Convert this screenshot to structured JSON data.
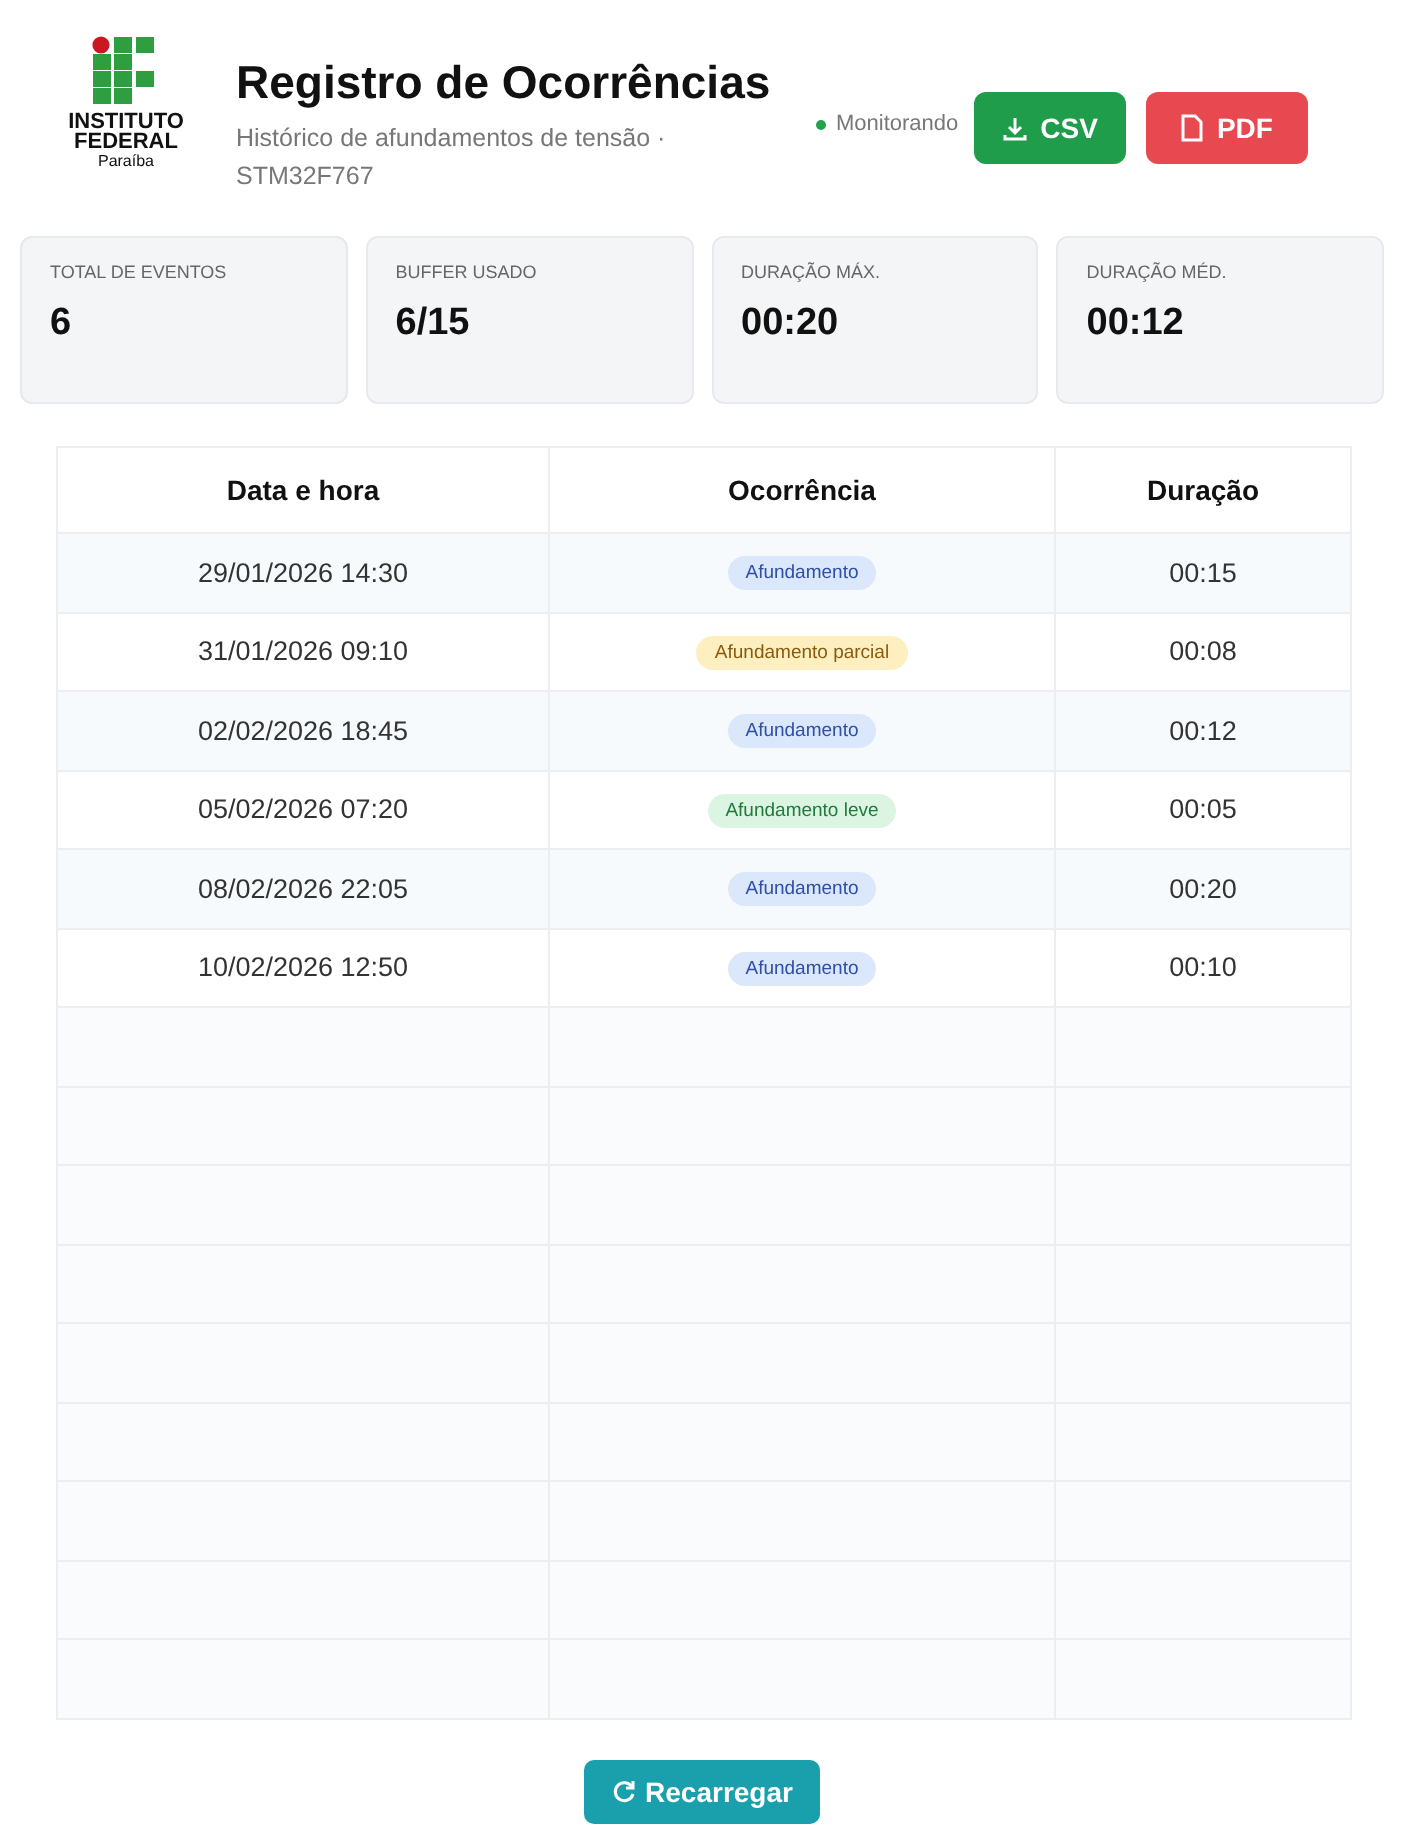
{
  "logo": {
    "line_1": "INSTITUTO",
    "line_2": "FEDERAL",
    "line_3": "Paraíba"
  },
  "header": {
    "title": "Registro de Ocorrências",
    "subtitle": "Histórico de afundamentos de tensão · STM32F767",
    "status": {
      "label": "Monitorando",
      "on": true
    },
    "buttons": [
      {
        "label": "CSV",
        "kind": "csv"
      },
      {
        "label": "PDF",
        "kind": "pdf"
      }
    ]
  },
  "stats": [
    {
      "label": "TOTAL DE EVENTOS",
      "value": "6"
    },
    {
      "label": "BUFFER USADO",
      "value": "6/15"
    },
    {
      "label": "DURAÇÃO MÁX.",
      "value": "00:20"
    },
    {
      "label": "DURAÇÃO MÉD.",
      "value": "00:12"
    }
  ],
  "table": {
    "columns": [
      "Data e hora",
      "Ocorrência",
      "Duração"
    ],
    "rows": [
      {
        "kind": "event",
        "datetime": "29/01/2026 14:30",
        "event": {
          "label": "Afundamento",
          "kind": "full"
        },
        "duration": "00:15"
      },
      {
        "kind": "event",
        "datetime": "31/01/2026 09:10",
        "event": {
          "label": "Afundamento parcial",
          "kind": "partial"
        },
        "duration": "00:08"
      },
      {
        "kind": "event",
        "datetime": "02/02/2026 18:45",
        "event": {
          "label": "Afundamento",
          "kind": "full"
        },
        "duration": "00:12"
      },
      {
        "kind": "event",
        "datetime": "05/02/2026 07:20",
        "event": {
          "label": "Afundamento leve",
          "kind": "light"
        },
        "duration": "00:05"
      },
      {
        "kind": "event",
        "datetime": "08/02/2026 22:05",
        "event": {
          "label": "Afundamento",
          "kind": "full"
        },
        "duration": "00:20"
      },
      {
        "kind": "event",
        "datetime": "10/02/2026 12:50",
        "event": {
          "label": "Afundamento",
          "kind": "full"
        },
        "duration": "00:10"
      },
      {
        "kind": "empty"
      },
      {
        "kind": "empty"
      },
      {
        "kind": "empty"
      },
      {
        "kind": "empty"
      },
      {
        "kind": "empty"
      },
      {
        "kind": "empty"
      },
      {
        "kind": "empty"
      },
      {
        "kind": "empty"
      },
      {
        "kind": "empty"
      }
    ]
  },
  "reload_button": {
    "label": "Recarregar"
  }
}
